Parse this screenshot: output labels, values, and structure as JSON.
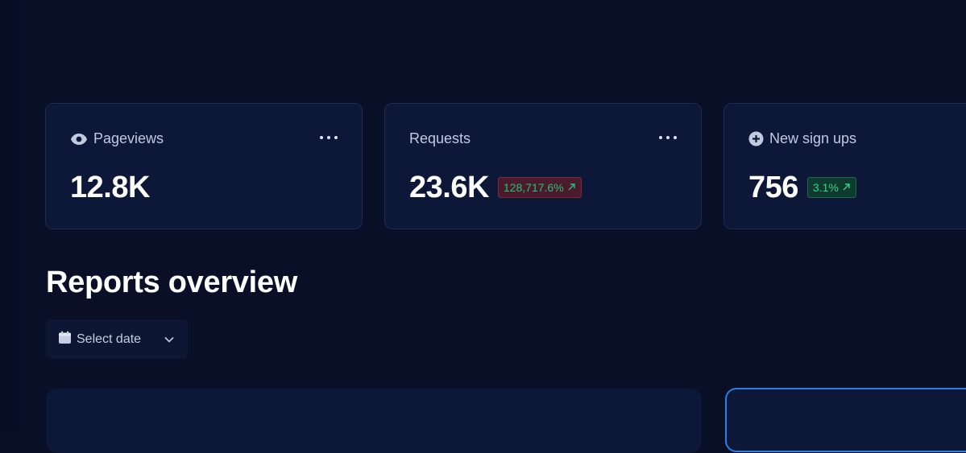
{
  "stats": [
    {
      "label": "Pageviews",
      "icon": "eye-icon",
      "value": "12.8K",
      "badge": null
    },
    {
      "label": "Requests",
      "icon": null,
      "value": "23.6K",
      "badge": {
        "text": "128,717.6%",
        "color": "#2fbe78",
        "bg": "#4a1a2d"
      }
    },
    {
      "label": "New sign ups",
      "icon": "plus-circle-icon",
      "value": "756",
      "badge": {
        "text": "3.1%",
        "color": "#37d389",
        "bg": "#0f3a2f"
      }
    }
  ],
  "reports": {
    "title": "Reports overview",
    "date_select_label": "Select date"
  },
  "colors": {
    "background": "#080f26",
    "card": "#0d1838",
    "accent": "#2a7fe0"
  }
}
